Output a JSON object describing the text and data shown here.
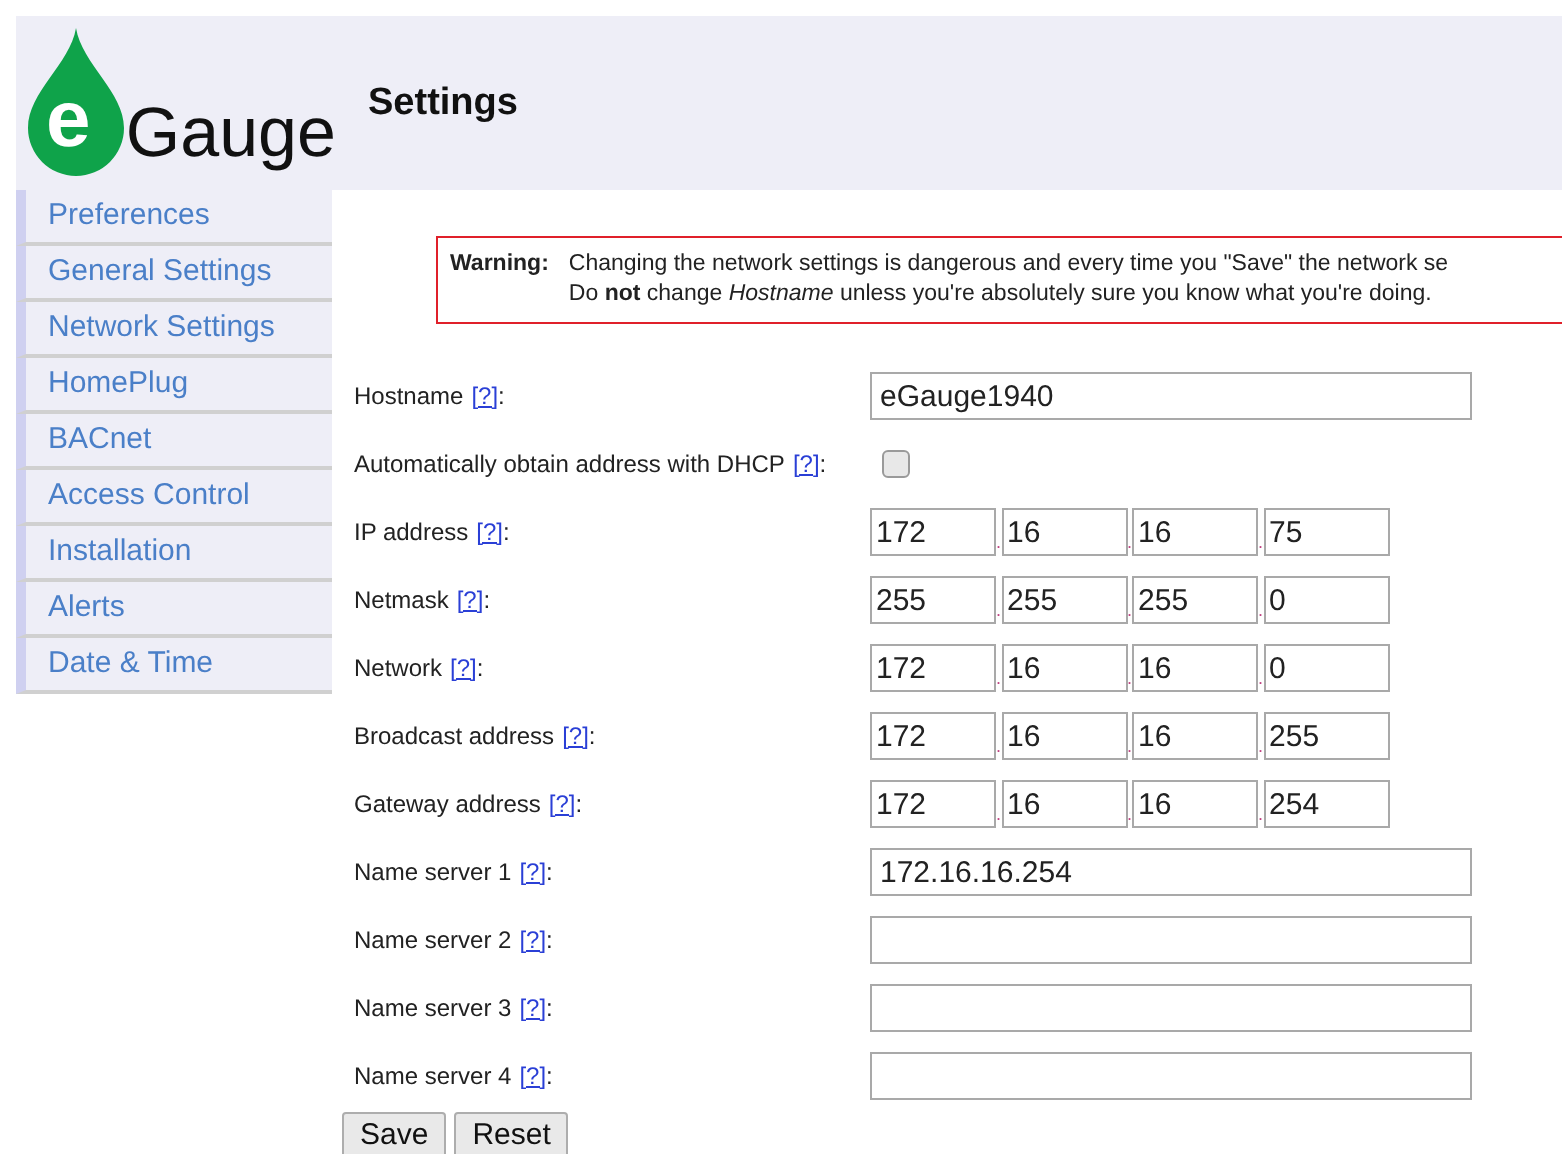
{
  "logo": {
    "mark": "e",
    "name": "Gauge"
  },
  "header": {
    "title": "Settings"
  },
  "sidebar": {
    "items": [
      {
        "label": "Preferences",
        "selected": false
      },
      {
        "label": "General Settings",
        "selected": false
      },
      {
        "label": "Network Settings",
        "selected": false
      },
      {
        "label": "HomePlug",
        "selected": false
      },
      {
        "label": "BACnet",
        "selected": false
      },
      {
        "label": "Access Control",
        "selected": false
      },
      {
        "label": "Installation",
        "selected": false
      },
      {
        "label": "Alerts",
        "selected": false
      },
      {
        "label": "Date & Time",
        "selected": false
      }
    ]
  },
  "warning": {
    "label": "Warning:",
    "lines": [
      "Changing the network settings is dangerous and every time you \"Save\" the network se",
      "Do **not** change *Hostname* unless you're absolutely sure you know what you're doing."
    ]
  },
  "fields": [
    {
      "kind": "text",
      "label": "Hostname",
      "help": "[?]",
      "suffix": ":",
      "value": "eGauge1940"
    },
    {
      "kind": "checkbox",
      "label": "Automatically obtain address with DHCP",
      "help": "[?]",
      "suffix": ":",
      "checked": false
    },
    {
      "kind": "address",
      "label": "IP address",
      "help": "[?]",
      "suffix": ":",
      "octets": [
        {
          "value": "172"
        },
        {
          "sep": ".",
          "value": "16"
        },
        {
          "sep": ".",
          "value": "16"
        },
        {
          "sep": ".",
          "value": "75"
        }
      ]
    },
    {
      "kind": "address",
      "label": "Netmask",
      "help": "[?]",
      "suffix": ":",
      "octets": [
        {
          "value": "255"
        },
        {
          "sep": ".",
          "value": "255"
        },
        {
          "sep": ".",
          "value": "255"
        },
        {
          "sep": ".",
          "value": "0"
        }
      ]
    },
    {
      "kind": "address",
      "label": "Network",
      "help": "[?]",
      "suffix": ":",
      "octets": [
        {
          "value": "172"
        },
        {
          "sep": ".",
          "value": "16"
        },
        {
          "sep": ".",
          "value": "16"
        },
        {
          "sep": ".",
          "value": "0"
        }
      ]
    },
    {
      "kind": "address",
      "label": "Broadcast address",
      "help": "[?]",
      "suffix": ":",
      "octets": [
        {
          "value": "172"
        },
        {
          "sep": ".",
          "value": "16"
        },
        {
          "sep": ".",
          "value": "16"
        },
        {
          "sep": ".",
          "value": "255"
        }
      ]
    },
    {
      "kind": "address",
      "label": "Gateway address",
      "help": "[?]",
      "suffix": ":",
      "octets": [
        {
          "value": "172"
        },
        {
          "sep": ".",
          "value": "16"
        },
        {
          "sep": ".",
          "value": "16"
        },
        {
          "sep": ".",
          "value": "254"
        }
      ]
    },
    {
      "kind": "text",
      "label": "Name server 1",
      "help": "[?]",
      "suffix": ":",
      "value": "172.16.16.254"
    },
    {
      "kind": "text",
      "label": "Name server 2",
      "help": "[?]",
      "suffix": ":"
    },
    {
      "kind": "text",
      "label": "Name server 3",
      "help": "[?]",
      "suffix": ":"
    },
    {
      "kind": "text",
      "label": "Name server 4",
      "help": "[?]",
      "suffix": ":"
    }
  ],
  "buttons": [
    "Save",
    "Reset"
  ]
}
